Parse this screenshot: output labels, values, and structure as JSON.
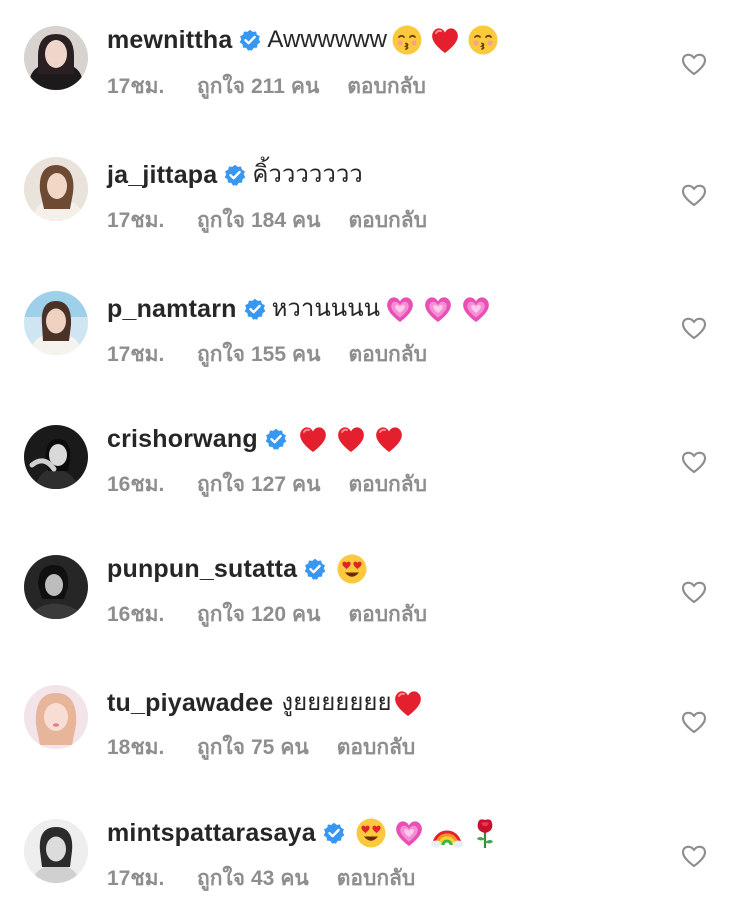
{
  "labels": {
    "likes_prefix": "ถูกใจ",
    "likes_suffix": "คน",
    "reply": "ตอบกลับ"
  },
  "colors": {
    "verified": "#3897f0",
    "meta_text": "#8e8e8e",
    "username": "#262626",
    "heart_outline": "#8e8e8e"
  },
  "comments": [
    {
      "username": "mewnittha",
      "verified": true,
      "text": "Awwwwww",
      "emojis": [
        "kissing-face-emoji",
        "red-heart-emoji",
        "kissing-face-emoji"
      ],
      "time": "17ชม.",
      "likes": "211"
    },
    {
      "username": "ja_jittapa",
      "verified": true,
      "text": "คิ้ววววววว",
      "emojis": [],
      "time": "17ชม.",
      "likes": "184"
    },
    {
      "username": "p_namtarn",
      "verified": true,
      "text": "หวานนนน",
      "emojis": [
        "sparkling-heart-emoji",
        "sparkling-heart-emoji",
        "sparkling-heart-emoji"
      ],
      "time": "17ชม.",
      "likes": "155"
    },
    {
      "username": "crishorwang",
      "verified": true,
      "text": "",
      "emojis": [
        "red-heart-emoji",
        "red-heart-emoji",
        "red-heart-emoji"
      ],
      "time": "16ชม.",
      "likes": "127"
    },
    {
      "username": "punpun_sutatta",
      "verified": true,
      "text": "",
      "emojis": [
        "heart-eyes-emoji"
      ],
      "time": "16ชม.",
      "likes": "120"
    },
    {
      "username": "tu_piyawadee",
      "verified": false,
      "text": "งูยยยยยยย",
      "emojis": [
        "red-heart-emoji"
      ],
      "time": "18ชม.",
      "likes": "75"
    },
    {
      "username": "mintspattarasaya",
      "verified": true,
      "text": "",
      "emojis": [
        "heart-eyes-emoji",
        "sparkling-heart-emoji",
        "rainbow-emoji",
        "rose-emoji"
      ],
      "time": "17ชม.",
      "likes": "43"
    }
  ]
}
